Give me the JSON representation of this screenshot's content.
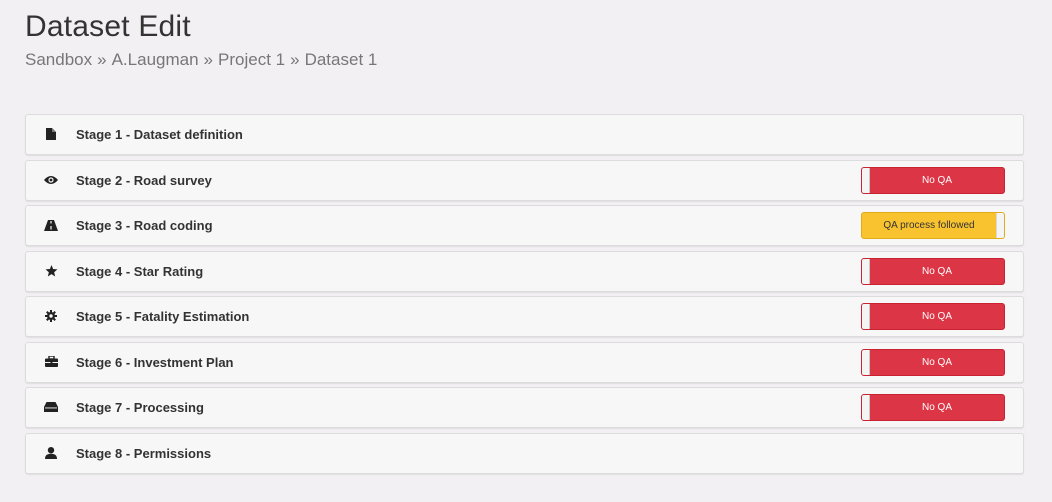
{
  "header": {
    "title": "Dataset Edit",
    "breadcrumb": [
      "Sandbox",
      "A.Laugman",
      "Project 1",
      "Dataset 1"
    ],
    "separator": "»"
  },
  "colors": {
    "no_qa": "#dc3545",
    "qa_followed": "#f9c32f",
    "panel": "#f7f7f7"
  },
  "stages": [
    {
      "label": "Stage 1 - Dataset definition",
      "icon": "file-icon",
      "qa": null
    },
    {
      "label": "Stage 2 - Road survey",
      "icon": "eye-icon",
      "qa": {
        "state": "off",
        "label": "No QA"
      }
    },
    {
      "label": "Stage 3 - Road coding",
      "icon": "road-icon",
      "qa": {
        "state": "on",
        "label": "QA process followed"
      }
    },
    {
      "label": "Stage 4 - Star Rating",
      "icon": "star-icon",
      "qa": {
        "state": "off",
        "label": "No QA"
      }
    },
    {
      "label": "Stage 5 - Fatality Estimation",
      "icon": "gear-icon",
      "qa": {
        "state": "off",
        "label": "No QA"
      }
    },
    {
      "label": "Stage 6 - Investment Plan",
      "icon": "briefcase-icon",
      "qa": {
        "state": "off",
        "label": "No QA"
      }
    },
    {
      "label": "Stage 7 - Processing",
      "icon": "hdd-icon",
      "qa": {
        "state": "off",
        "label": "No QA"
      }
    },
    {
      "label": "Stage 8 - Permissions",
      "icon": "user-icon",
      "qa": null
    }
  ]
}
